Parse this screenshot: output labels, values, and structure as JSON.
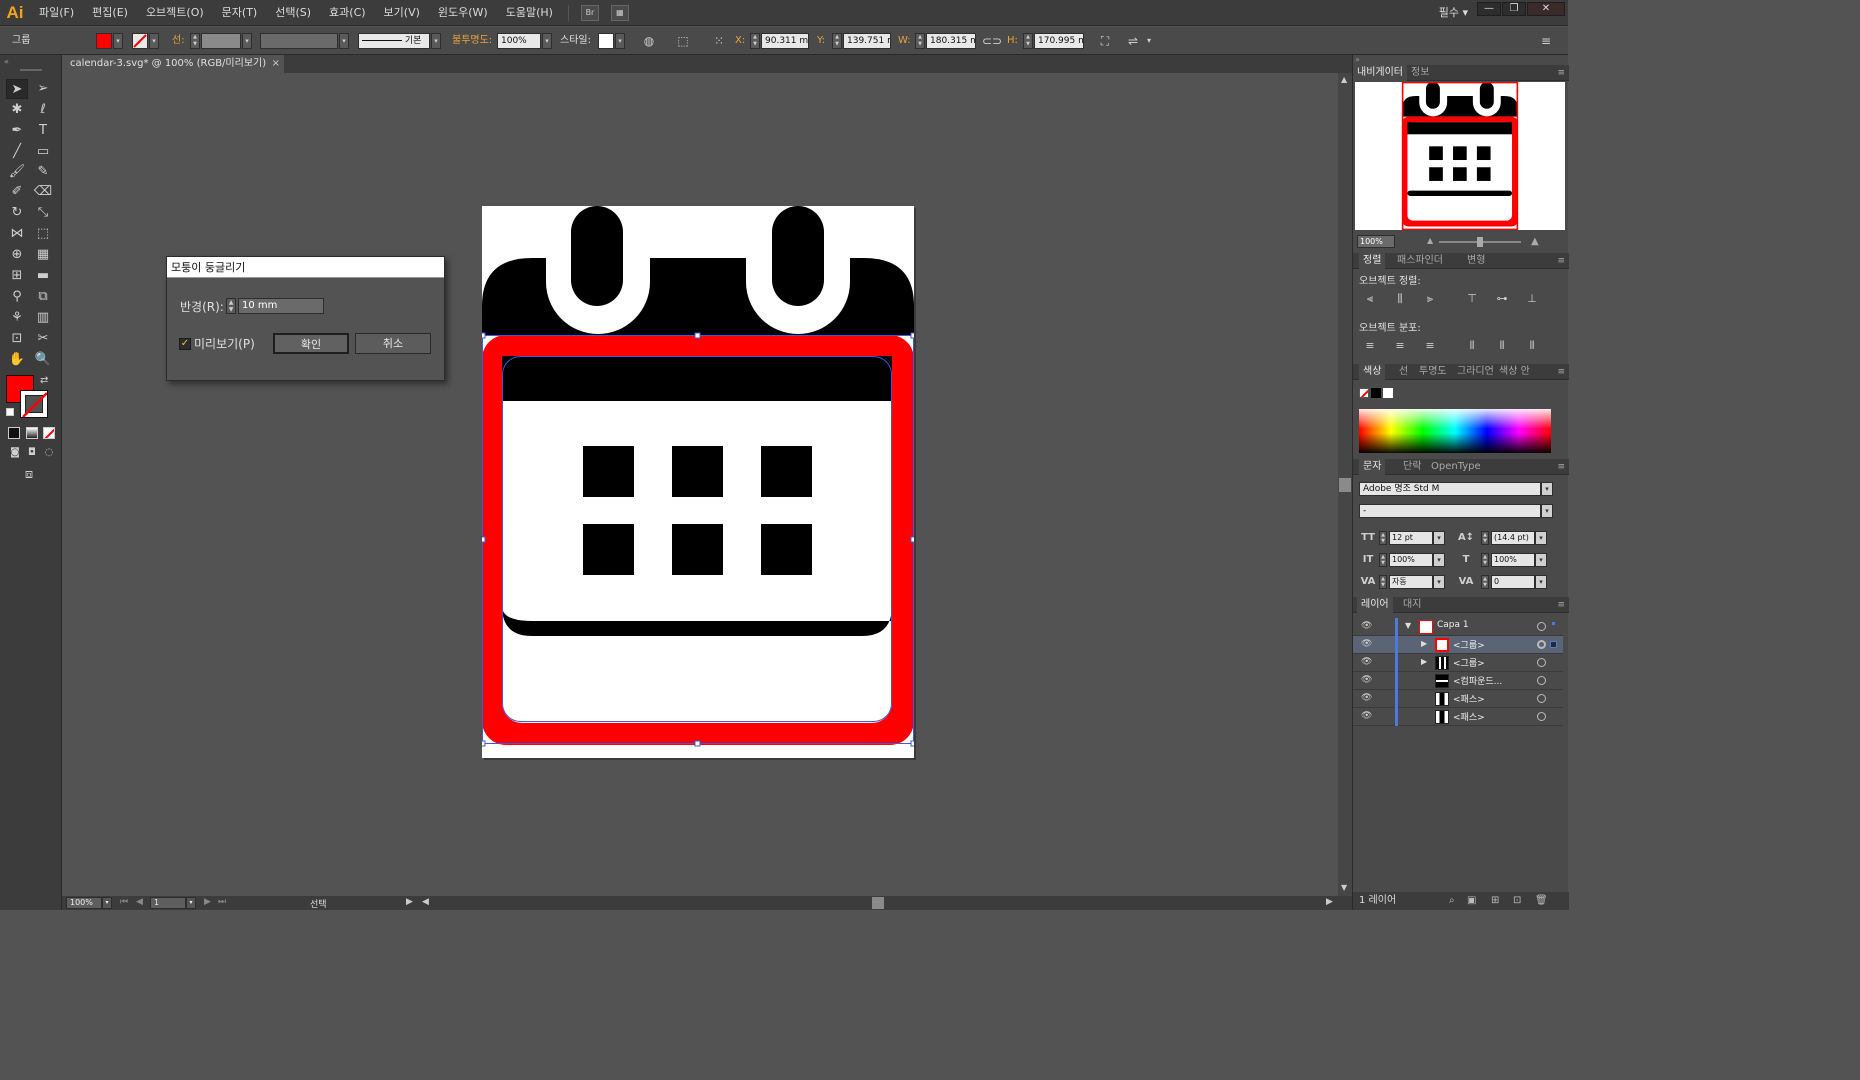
{
  "app": {
    "logo": "Ai",
    "workspace": "필수"
  },
  "menu": [
    "파일(F)",
    "편집(E)",
    "오브젝트(O)",
    "문자(T)",
    "선택(S)",
    "효과(C)",
    "보기(V)",
    "윈도우(W)",
    "도움말(H)"
  ],
  "menu_extra": {
    "bridge_button": "Br"
  },
  "window_controls": {
    "minimize": "—",
    "restore": "❐",
    "close": "✕"
  },
  "controlbar": {
    "selection_type": "그룹",
    "fill_color": "#ff0000",
    "stroke_label": "선:",
    "stroke_style_label": "기본",
    "opacity_label": "불투명도:",
    "opacity_value": "100%",
    "style_label": "스타일:",
    "x_label": "X:",
    "x_value": "90.311 mm",
    "y_label": "Y:",
    "y_value": "139.751 mm",
    "w_label": "W:",
    "w_value": "180.315 mm",
    "h_label": "H:",
    "h_value": "170.995 mm"
  },
  "document_tab": {
    "title": "calendar-3.svg* @ 100% (RGB/미리보기)",
    "close": "×"
  },
  "dialog": {
    "title": "모퉁이 둥글리기",
    "radius_label": "반경(R):",
    "radius_value": "10 mm",
    "preview_label": "미리보기(P)",
    "preview_checked": true,
    "ok_label": "확인",
    "cancel_label": "취소"
  },
  "colors": {
    "accent": "#ff0000",
    "artwork_black": "#000000",
    "selection_blue": "#3c5adc"
  },
  "status": {
    "zoom": "100%",
    "artboard_number": "1",
    "tool_name": "선택"
  },
  "panels": {
    "navigator_tabs": [
      "내비게이터",
      "정보"
    ],
    "navigator_zoom": "100%",
    "align_tabs": [
      "정렬",
      "패스파인더",
      "변형"
    ],
    "align_objects_label": "오브젝트 정렬:",
    "distribute_objects_label": "오브젝트 분포:",
    "color_tabs": [
      "색상",
      "선",
      "투명도",
      "그라디언",
      "색상 안"
    ],
    "character_tabs": [
      "문자",
      "단락",
      "OpenType"
    ],
    "font_family": "Adobe 명조 Std M",
    "font_style": "-",
    "font_size": "12 pt",
    "leading": "(14.4 pt)",
    "vertical_scale": "100%",
    "horizontal_scale": "100%",
    "kerning": "자동",
    "tracking": "0",
    "layers_tabs": [
      "레이어",
      "대지"
    ],
    "layers": [
      {
        "name": "Capa 1",
        "level": 0,
        "expanded": true,
        "selected": false
      },
      {
        "name": "<그룹>",
        "level": 1,
        "expanded": false,
        "selected": true
      },
      {
        "name": "<그룹>",
        "level": 1,
        "expanded": false,
        "selected": false
      },
      {
        "name": "<컴파운드...",
        "level": 1,
        "expanded": null,
        "selected": false
      },
      {
        "name": "<패스>",
        "level": 1,
        "expanded": null,
        "selected": false
      },
      {
        "name": "<패스>",
        "level": 1,
        "expanded": null,
        "selected": false
      }
    ],
    "layers_count": "1 레이어"
  }
}
